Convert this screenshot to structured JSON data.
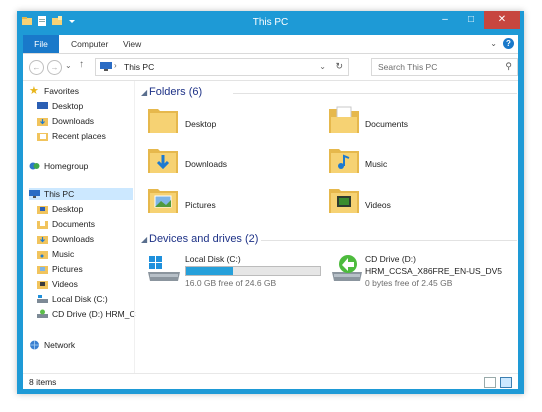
{
  "window": {
    "title": "This PC"
  },
  "ribbon": {
    "tabs": [
      "File",
      "Computer",
      "View"
    ]
  },
  "address": {
    "path": "This PC",
    "search_placeholder": "Search This PC"
  },
  "nav": {
    "favorites": {
      "label": "Favorites",
      "items": [
        "Desktop",
        "Downloads",
        "Recent places"
      ]
    },
    "homegroup": "Homegroup",
    "thispc": {
      "label": "This PC",
      "items": [
        "Desktop",
        "Documents",
        "Downloads",
        "Music",
        "Pictures",
        "Videos",
        "Local Disk (C:)",
        "CD Drive (D:) HRM_C"
      ]
    },
    "network": "Network"
  },
  "folders": {
    "heading": "Folders (6)",
    "items": [
      "Desktop",
      "Documents",
      "Downloads",
      "Music",
      "Pictures",
      "Videos"
    ]
  },
  "devices": {
    "heading": "Devices and drives (2)",
    "drives": [
      {
        "name": "Local Disk (C:)",
        "free": "16.0 GB free of 24.6 GB",
        "used_fraction": 0.35
      },
      {
        "name": "CD Drive (D:)",
        "label": "HRM_CCSA_X86FRE_EN-US_DV5",
        "free": "0 bytes free of 2.45 GB"
      }
    ]
  },
  "status": {
    "count": "8 items"
  },
  "colors": {
    "titlebar": "#1e9ad6",
    "close": "#c7463f",
    "accent": "#1979ca",
    "heading": "#1e3287",
    "drive_fill": "#26a0da"
  }
}
